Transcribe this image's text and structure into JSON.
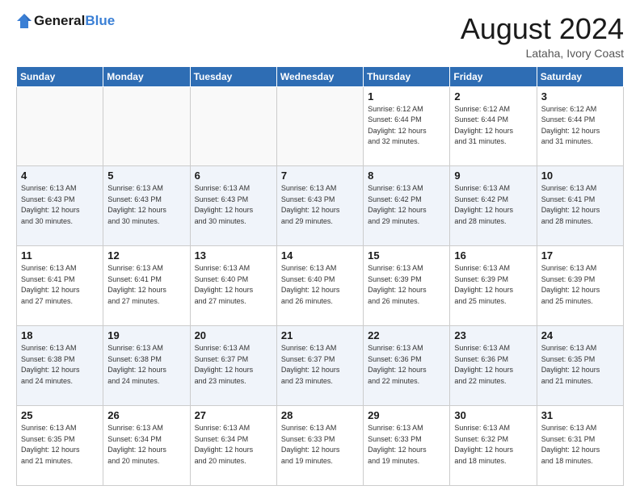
{
  "logo": {
    "text_general": "General",
    "text_blue": "Blue"
  },
  "calendar": {
    "title": "August 2024",
    "subtitle": "Lataha, Ivory Coast",
    "weekdays": [
      "Sunday",
      "Monday",
      "Tuesday",
      "Wednesday",
      "Thursday",
      "Friday",
      "Saturday"
    ],
    "weeks": [
      [
        {
          "day": "",
          "info": ""
        },
        {
          "day": "",
          "info": ""
        },
        {
          "day": "",
          "info": ""
        },
        {
          "day": "",
          "info": ""
        },
        {
          "day": "1",
          "info": "Sunrise: 6:12 AM\nSunset: 6:44 PM\nDaylight: 12 hours\nand 32 minutes."
        },
        {
          "day": "2",
          "info": "Sunrise: 6:12 AM\nSunset: 6:44 PM\nDaylight: 12 hours\nand 31 minutes."
        },
        {
          "day": "3",
          "info": "Sunrise: 6:12 AM\nSunset: 6:44 PM\nDaylight: 12 hours\nand 31 minutes."
        }
      ],
      [
        {
          "day": "4",
          "info": "Sunrise: 6:13 AM\nSunset: 6:43 PM\nDaylight: 12 hours\nand 30 minutes."
        },
        {
          "day": "5",
          "info": "Sunrise: 6:13 AM\nSunset: 6:43 PM\nDaylight: 12 hours\nand 30 minutes."
        },
        {
          "day": "6",
          "info": "Sunrise: 6:13 AM\nSunset: 6:43 PM\nDaylight: 12 hours\nand 30 minutes."
        },
        {
          "day": "7",
          "info": "Sunrise: 6:13 AM\nSunset: 6:43 PM\nDaylight: 12 hours\nand 29 minutes."
        },
        {
          "day": "8",
          "info": "Sunrise: 6:13 AM\nSunset: 6:42 PM\nDaylight: 12 hours\nand 29 minutes."
        },
        {
          "day": "9",
          "info": "Sunrise: 6:13 AM\nSunset: 6:42 PM\nDaylight: 12 hours\nand 28 minutes."
        },
        {
          "day": "10",
          "info": "Sunrise: 6:13 AM\nSunset: 6:41 PM\nDaylight: 12 hours\nand 28 minutes."
        }
      ],
      [
        {
          "day": "11",
          "info": "Sunrise: 6:13 AM\nSunset: 6:41 PM\nDaylight: 12 hours\nand 27 minutes."
        },
        {
          "day": "12",
          "info": "Sunrise: 6:13 AM\nSunset: 6:41 PM\nDaylight: 12 hours\nand 27 minutes."
        },
        {
          "day": "13",
          "info": "Sunrise: 6:13 AM\nSunset: 6:40 PM\nDaylight: 12 hours\nand 27 minutes."
        },
        {
          "day": "14",
          "info": "Sunrise: 6:13 AM\nSunset: 6:40 PM\nDaylight: 12 hours\nand 26 minutes."
        },
        {
          "day": "15",
          "info": "Sunrise: 6:13 AM\nSunset: 6:39 PM\nDaylight: 12 hours\nand 26 minutes."
        },
        {
          "day": "16",
          "info": "Sunrise: 6:13 AM\nSunset: 6:39 PM\nDaylight: 12 hours\nand 25 minutes."
        },
        {
          "day": "17",
          "info": "Sunrise: 6:13 AM\nSunset: 6:39 PM\nDaylight: 12 hours\nand 25 minutes."
        }
      ],
      [
        {
          "day": "18",
          "info": "Sunrise: 6:13 AM\nSunset: 6:38 PM\nDaylight: 12 hours\nand 24 minutes."
        },
        {
          "day": "19",
          "info": "Sunrise: 6:13 AM\nSunset: 6:38 PM\nDaylight: 12 hours\nand 24 minutes."
        },
        {
          "day": "20",
          "info": "Sunrise: 6:13 AM\nSunset: 6:37 PM\nDaylight: 12 hours\nand 23 minutes."
        },
        {
          "day": "21",
          "info": "Sunrise: 6:13 AM\nSunset: 6:37 PM\nDaylight: 12 hours\nand 23 minutes."
        },
        {
          "day": "22",
          "info": "Sunrise: 6:13 AM\nSunset: 6:36 PM\nDaylight: 12 hours\nand 22 minutes."
        },
        {
          "day": "23",
          "info": "Sunrise: 6:13 AM\nSunset: 6:36 PM\nDaylight: 12 hours\nand 22 minutes."
        },
        {
          "day": "24",
          "info": "Sunrise: 6:13 AM\nSunset: 6:35 PM\nDaylight: 12 hours\nand 21 minutes."
        }
      ],
      [
        {
          "day": "25",
          "info": "Sunrise: 6:13 AM\nSunset: 6:35 PM\nDaylight: 12 hours\nand 21 minutes."
        },
        {
          "day": "26",
          "info": "Sunrise: 6:13 AM\nSunset: 6:34 PM\nDaylight: 12 hours\nand 20 minutes."
        },
        {
          "day": "27",
          "info": "Sunrise: 6:13 AM\nSunset: 6:34 PM\nDaylight: 12 hours\nand 20 minutes."
        },
        {
          "day": "28",
          "info": "Sunrise: 6:13 AM\nSunset: 6:33 PM\nDaylight: 12 hours\nand 19 minutes."
        },
        {
          "day": "29",
          "info": "Sunrise: 6:13 AM\nSunset: 6:33 PM\nDaylight: 12 hours\nand 19 minutes."
        },
        {
          "day": "30",
          "info": "Sunrise: 6:13 AM\nSunset: 6:32 PM\nDaylight: 12 hours\nand 18 minutes."
        },
        {
          "day": "31",
          "info": "Sunrise: 6:13 AM\nSunset: 6:31 PM\nDaylight: 12 hours\nand 18 minutes."
        }
      ]
    ]
  }
}
